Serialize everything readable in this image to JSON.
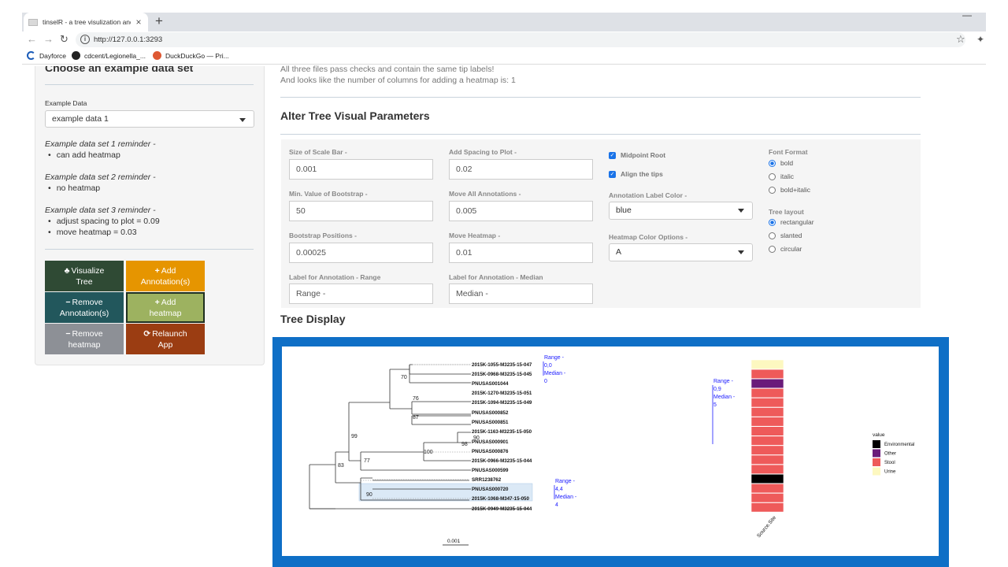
{
  "browser": {
    "tab_title": "tinselR - a tree visulization and a",
    "url": "http://127.0.0.1:3293",
    "bookmarks": [
      "Dayforce",
      "cdcent/Legionella_...",
      "DuckDuckGo — Pri..."
    ]
  },
  "sidebar": {
    "title": "Choose an example data set",
    "example_label": "Example Data",
    "example_value": "example data 1",
    "reminders": [
      {
        "title": "Example data set 1 reminder -",
        "items": [
          "can add heatmap"
        ]
      },
      {
        "title": "Example data set 2 reminder -",
        "items": [
          "no heatmap"
        ]
      },
      {
        "title": "Example data set 3 reminder -",
        "items": [
          "adjust spacing to plot = 0.09",
          "move heatmap = 0.03"
        ]
      }
    ],
    "buttons": {
      "visualize": {
        "line1": "Visualize",
        "line2": "Tree"
      },
      "add_annotation": {
        "line1": "Add",
        "line2": "Annotation(s)"
      },
      "remove_annotation": {
        "line1": "Remove",
        "line2": "Annotation(s)"
      },
      "add_heatmap": {
        "line1": "Add",
        "line2": "heatmap"
      },
      "remove_heatmap": {
        "line1": "Remove",
        "line2": "heatmap"
      },
      "relaunch": {
        "line1": "Relaunch",
        "line2": "App"
      }
    }
  },
  "main": {
    "message1": "All three files pass checks and contain the same tip labels!",
    "message2": "And looks like the number of columns for adding a heatmap is:  1",
    "params_title": "Alter Tree Visual Parameters",
    "fields": {
      "scale_bar": {
        "label": "Size of Scale Bar -",
        "value": "0.001"
      },
      "spacing": {
        "label": "Add Spacing to Plot -",
        "value": "0.02"
      },
      "min_bootstrap": {
        "label": "Min. Value of Bootstrap -",
        "value": "50"
      },
      "move_annotations": {
        "label": "Move All Annotations -",
        "value": "0.005"
      },
      "bootstrap_pos": {
        "label": "Bootstrap Positions -",
        "value": "0.00025"
      },
      "move_heatmap": {
        "label": "Move Heatmap -",
        "value": "0.01"
      },
      "label_range": {
        "label": "Label for Annotation - Range",
        "value": "Range -"
      },
      "label_median": {
        "label": "Label for Annotation - Median",
        "value": "Median -"
      }
    },
    "checkboxes": {
      "midpoint": "Midpoint Root",
      "align": "Align the tips"
    },
    "annotation_color": {
      "label": "Annotation Label Color -",
      "value": "blue"
    },
    "heatmap_color": {
      "label": "Heatmap Color Options -",
      "value": "A"
    },
    "font_format": {
      "label": "Font Format",
      "options": [
        "bold",
        "italic",
        "bold+italic"
      ],
      "selected": "bold"
    },
    "tree_layout": {
      "label": "Tree layout",
      "options": [
        "rectangular",
        "slanted",
        "circular"
      ],
      "selected": "rectangular"
    },
    "tree_title": "Tree Display"
  },
  "tree": {
    "tips": [
      "2015K-1055-M3235-15-047",
      "2015K-0968-M3235-15-045",
      "PNUSAS001044",
      "2015K-1270-M3235-15-051",
      "2015K-1094-M3235-15-049",
      "PNUSAS000852",
      "PNUSAS000851",
      "2015K-1163-M3235-15-050",
      "PNUSAS000901",
      "PNUSAS000876",
      "2015K-0966-M3235-15-044",
      "PNUSAS000599",
      "SRR1238762",
      "PNUSAS000720",
      "2015K-1068-M347-15-050",
      "2015K-0949-M3235-15-044"
    ],
    "bootstraps": [
      "70",
      "76",
      "87",
      "99",
      "90",
      "98",
      "100",
      "77",
      "83",
      "90"
    ],
    "annotations": [
      {
        "range": "Range -",
        "range_val": "0,0",
        "median": "Median -",
        "median_val": "0"
      },
      {
        "range": "Range -",
        "range_val": "0,9",
        "median": "Median -",
        "median_val": "5"
      },
      {
        "range": "Range -",
        "range_val": "4,4",
        "median": "Median -",
        "median_val": "4"
      }
    ],
    "scale_label": "0.001",
    "heatmap_column": "Source.Site",
    "heatmap_values": [
      "Urine",
      "Stool",
      "Other",
      "Stool",
      "Stool",
      "Stool",
      "Stool",
      "Stool",
      "Stool",
      "Stool",
      "Stool",
      "Stool",
      "Environmental",
      "Stool",
      "Stool",
      "Stool"
    ],
    "legend_title": "value",
    "legend": [
      {
        "name": "Environmental",
        "color": "#000000"
      },
      {
        "name": "Other",
        "color": "#6a1b7a"
      },
      {
        "name": "Stool",
        "color": "#ee5a5a"
      },
      {
        "name": "Urine",
        "color": "#fdf8c0"
      }
    ]
  }
}
